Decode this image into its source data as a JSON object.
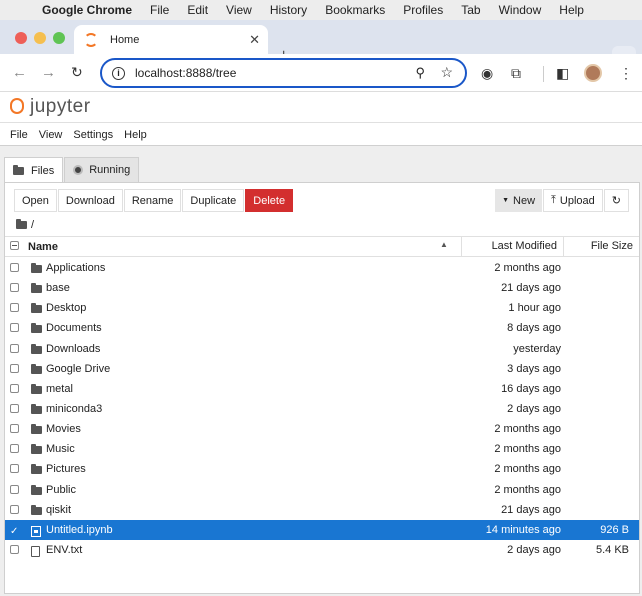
{
  "os_menubar": {
    "app": "Google Chrome",
    "items": [
      "File",
      "Edit",
      "View",
      "History",
      "Bookmarks",
      "Profiles",
      "Tab",
      "Window",
      "Help"
    ]
  },
  "browser": {
    "tab_title": "Home",
    "url": "localhost:8888/tree"
  },
  "jupyter": {
    "wordmark": "jupyter",
    "menu": [
      "File",
      "View",
      "Settings",
      "Help"
    ],
    "tabs": {
      "files": "Files",
      "running": "Running"
    },
    "actions": {
      "open": "Open",
      "download": "Download",
      "rename": "Rename",
      "duplicate": "Duplicate",
      "delete": "Delete",
      "new": "New",
      "upload": "Upload"
    },
    "breadcrumb": "/",
    "columns": {
      "name": "Name",
      "modified": "Last Modified",
      "size": "File Size"
    },
    "files": [
      {
        "type": "folder",
        "name": "Applications",
        "modified": "2 months ago",
        "size": ""
      },
      {
        "type": "folder",
        "name": "base",
        "modified": "21 days ago",
        "size": ""
      },
      {
        "type": "folder",
        "name": "Desktop",
        "modified": "1 hour ago",
        "size": ""
      },
      {
        "type": "folder",
        "name": "Documents",
        "modified": "8 days ago",
        "size": ""
      },
      {
        "type": "folder",
        "name": "Downloads",
        "modified": "yesterday",
        "size": ""
      },
      {
        "type": "folder",
        "name": "Google Drive",
        "modified": "3 days ago",
        "size": ""
      },
      {
        "type": "folder",
        "name": "metal",
        "modified": "16 days ago",
        "size": ""
      },
      {
        "type": "folder",
        "name": "miniconda3",
        "modified": "2 days ago",
        "size": ""
      },
      {
        "type": "folder",
        "name": "Movies",
        "modified": "2 months ago",
        "size": ""
      },
      {
        "type": "folder",
        "name": "Music",
        "modified": "2 months ago",
        "size": ""
      },
      {
        "type": "folder",
        "name": "Pictures",
        "modified": "2 months ago",
        "size": ""
      },
      {
        "type": "folder",
        "name": "Public",
        "modified": "2 months ago",
        "size": ""
      },
      {
        "type": "folder",
        "name": "qiskit",
        "modified": "21 days ago",
        "size": ""
      },
      {
        "type": "notebook",
        "name": "Untitled.ipynb",
        "modified": "14 minutes ago",
        "size": "926 B",
        "selected": true
      },
      {
        "type": "file",
        "name": "ENV.txt",
        "modified": "2 days ago",
        "size": "5.4 KB"
      }
    ]
  },
  "colors": {
    "selection": "#1976d2",
    "delete": "#d32f2f",
    "jupyter_orange": "#f37726",
    "omnibox_focus": "#1a57c8"
  }
}
